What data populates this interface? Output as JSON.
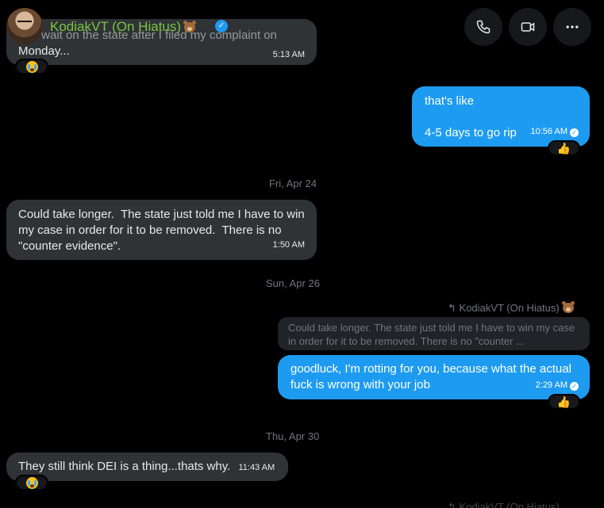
{
  "header": {
    "name": "KodiakVT (On Hiatus)",
    "verified_icon": "verified-badge-icon",
    "buttons": [
      "phone-icon",
      "video-call-icon",
      "more-options-icon"
    ]
  },
  "messages": [
    {
      "id": "m0",
      "direction": "in",
      "text_partial": "...to wait on the state after I filed my complaint on",
      "text_line2": "Monday...",
      "time": "5:13 AM",
      "reaction": "crying-face"
    },
    {
      "id": "m1",
      "direction": "out",
      "text": "that's like\n\n4-5 days to go rip",
      "time": "10:56 AM",
      "reaction": "thumbs-up"
    },
    {
      "id": "m2",
      "direction": "in",
      "text": "Could take longer.  The state just told me I have to win my case in order for it to be removed.  There is no \"counter evidence\".",
      "time": "1:50 AM"
    },
    {
      "id": "m3",
      "direction": "out",
      "reply_label": "KodiakVT (On Hiatus)",
      "quoted": "Could take longer.  The state just told me I have to win my case in order for it to be removed.  There is no \"counter ...",
      "text": "goodluck, I'm rotting for you, because what the actual fuck is wrong with your job",
      "time": "2:29 AM",
      "reaction": "thumbs-up"
    },
    {
      "id": "m4",
      "direction": "in",
      "text": "They still think DEI is a thing...thats why.",
      "time": "11:43 AM",
      "reaction": "crying-face"
    }
  ],
  "dates": [
    "Fri, Apr 24",
    "Sun, Apr 26",
    "Thu, Apr 30"
  ],
  "bottom_reply_label": "KodiakVT (On Hiatus)",
  "colors": {
    "background": "#000000",
    "incoming": "#2f3336",
    "outgoing": "#1d9bf0",
    "name": "#7cc442",
    "muted": "#71767b"
  }
}
